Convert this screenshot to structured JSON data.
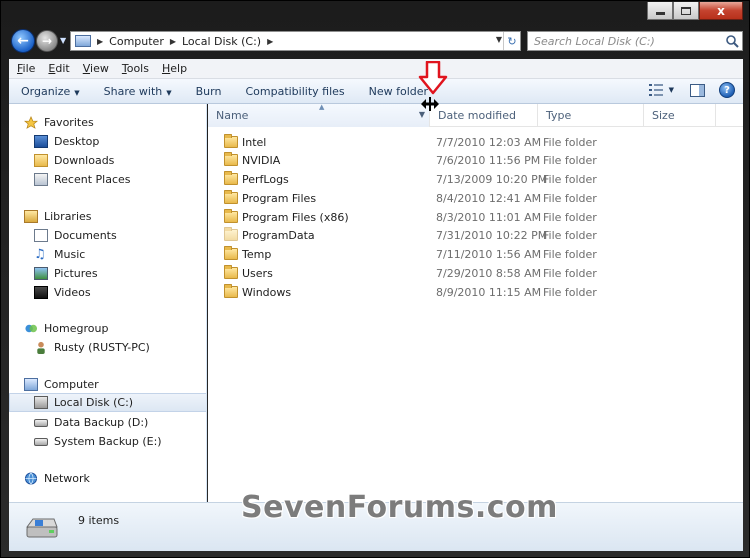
{
  "window": {
    "caption_close": "x"
  },
  "address": {
    "crumbs": [
      "Computer",
      "Local Disk (C:)"
    ],
    "search_placeholder": "Search Local Disk (C:)"
  },
  "menu": [
    {
      "u": "F",
      "rest": "ile"
    },
    {
      "u": "E",
      "rest": "dit"
    },
    {
      "u": "V",
      "rest": "iew"
    },
    {
      "u": "T",
      "rest": "ools"
    },
    {
      "u": "H",
      "rest": "elp"
    }
  ],
  "toolbar": {
    "organize": "Organize",
    "share_with": "Share with",
    "burn": "Burn",
    "compatibility": "Compatibility files",
    "new_folder": "New folder",
    "help": "?"
  },
  "nav": {
    "favorites": "Favorites",
    "desktop": "Desktop",
    "downloads": "Downloads",
    "recent_places": "Recent Places",
    "libraries": "Libraries",
    "documents": "Documents",
    "music": "Music",
    "pictures": "Pictures",
    "videos": "Videos",
    "homegroup": "Homegroup",
    "user": "Rusty (RUSTY-PC)",
    "computer": "Computer",
    "local_disk": "Local Disk (C:)",
    "data_backup": "Data Backup (D:)",
    "system_backup": "System Backup (E:)",
    "network": "Network"
  },
  "columns": {
    "name": "Name",
    "date": "Date modified",
    "type": "Type",
    "size": "Size"
  },
  "files": [
    {
      "name": "Intel",
      "date": "7/7/2010 12:03 AM",
      "type": "File folder"
    },
    {
      "name": "NVIDIA",
      "date": "7/6/2010 11:56 PM",
      "type": "File folder"
    },
    {
      "name": "PerfLogs",
      "date": "7/13/2009 10:20 PM",
      "type": "File folder"
    },
    {
      "name": "Program Files",
      "date": "8/4/2010 12:41 AM",
      "type": "File folder"
    },
    {
      "name": "Program Files (x86)",
      "date": "8/3/2010 11:01 AM",
      "type": "File folder"
    },
    {
      "name": "ProgramData",
      "date": "7/31/2010 10:22 PM",
      "type": "File folder"
    },
    {
      "name": "Temp",
      "date": "7/11/2010 1:56 AM",
      "type": "File folder"
    },
    {
      "name": "Users",
      "date": "7/29/2010 8:58 AM",
      "type": "File folder"
    },
    {
      "name": "Windows",
      "date": "8/9/2010 11:15 AM",
      "type": "File folder"
    }
  ],
  "status": {
    "item_count": "9 items"
  },
  "watermark": "SevenForums.com"
}
